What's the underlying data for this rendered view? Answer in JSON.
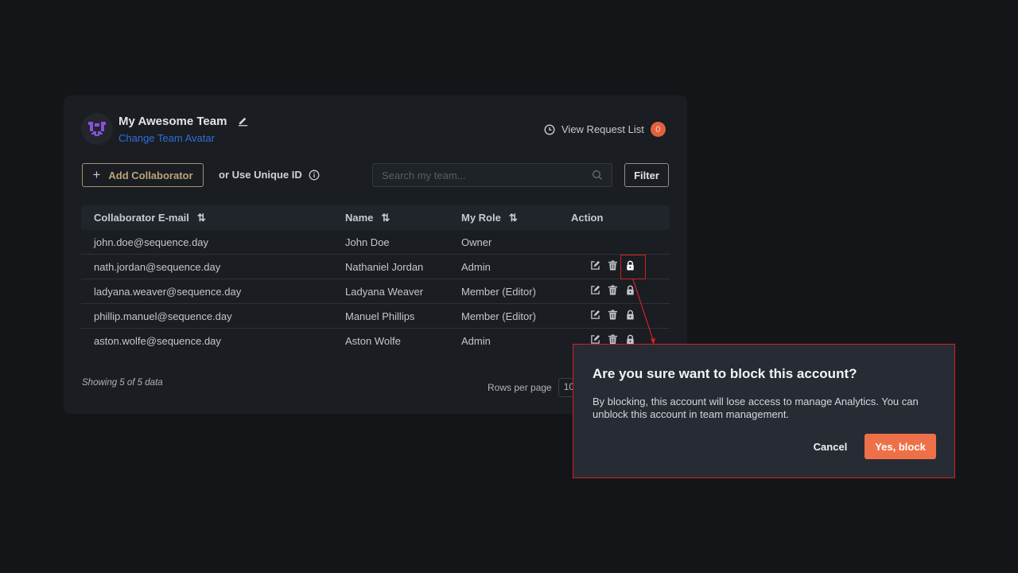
{
  "team": {
    "name": "My Awesome Team",
    "change_avatar": "Change Team Avatar"
  },
  "request": {
    "label": "View Request List",
    "count": "0"
  },
  "toolbar": {
    "add": "Add Collaborator",
    "unique": "or Use Unique ID",
    "search_placeholder": "Search my team...",
    "filter": "Filter"
  },
  "table": {
    "headers": [
      "Collaborator E-mail",
      "Name",
      "My Role",
      "Action"
    ],
    "rows": [
      {
        "email": "john.doe@sequence.day",
        "name": "John Doe",
        "role": "Owner",
        "actions": false
      },
      {
        "email": "nath.jordan@sequence.day",
        "name": "Nathaniel Jordan",
        "role": "Admin",
        "actions": true
      },
      {
        "email": "ladyana.weaver@sequence.day",
        "name": "Ladyana Weaver",
        "role": "Member (Editor)",
        "actions": true
      },
      {
        "email": "phillip.manuel@sequence.day",
        "name": "Manuel Phillips",
        "role": "Member (Editor)",
        "actions": true
      },
      {
        "email": "aston.wolfe@sequence.day",
        "name": "Aston Wolfe",
        "role": "Admin",
        "actions": true
      }
    ]
  },
  "footer": {
    "showing": "Showing 5 of 5 data",
    "rows_per_page": "Rows per page",
    "rows_value": "10"
  },
  "modal": {
    "title": "Are you sure want to block this account?",
    "body": "By blocking, this account will lose access to manage Analytics. You can unblock this account in team management.",
    "cancel": "Cancel",
    "confirm": "Yes, block"
  },
  "colors": {
    "accent": "#ee7048",
    "link": "#2f6fd6",
    "annotation": "#d42020"
  }
}
